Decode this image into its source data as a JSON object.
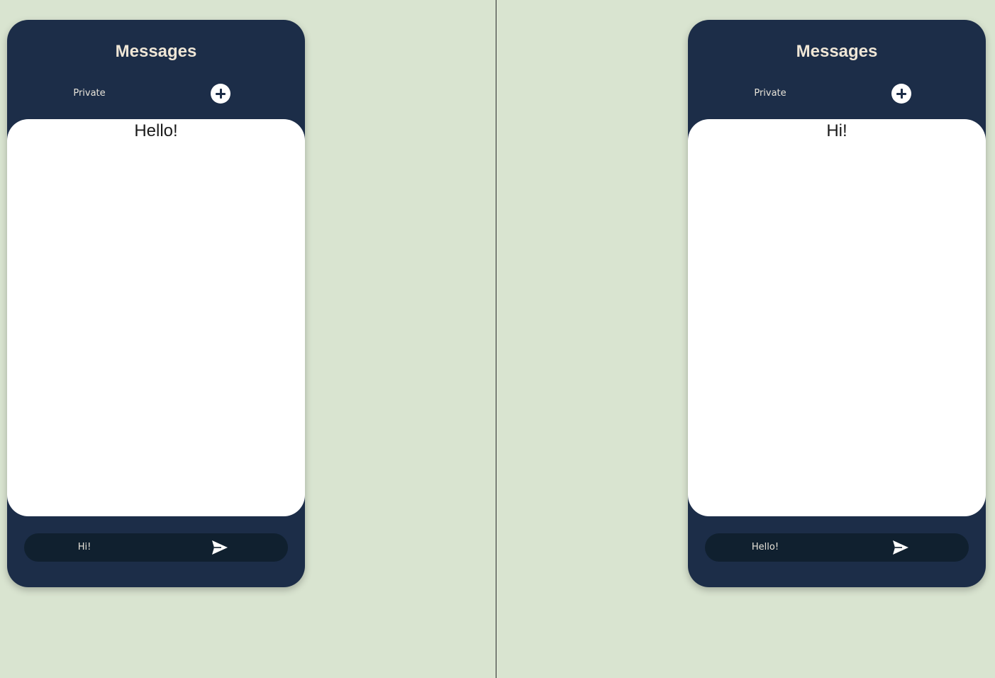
{
  "panels": [
    {
      "title": "Messages",
      "room_label": "Private",
      "add_icon": "plus-circle-icon",
      "messages": [
        "Hello!"
      ],
      "input_value": "Hi!",
      "send_icon": "send-icon"
    },
    {
      "title": "Messages",
      "room_label": "Private",
      "add_icon": "plus-circle-icon",
      "messages": [
        "Hi!"
      ],
      "input_value": "Hello!",
      "send_icon": "send-icon"
    }
  ],
  "colors": {
    "background": "#d9e4d0",
    "panel": "#1c2d48",
    "input": "#10202f",
    "title_text": "#efe6d6",
    "message_area": "#ffffff"
  }
}
